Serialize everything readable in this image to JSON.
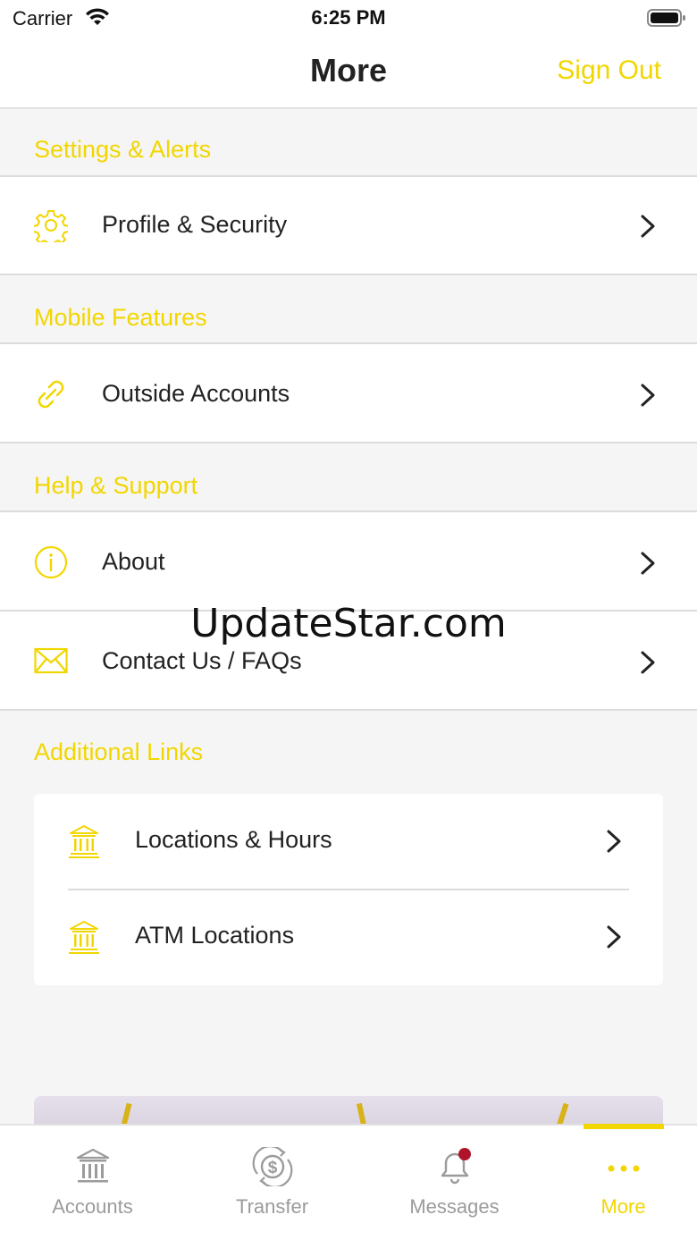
{
  "status_bar": {
    "carrier": "Carrier",
    "time": "6:25 PM"
  },
  "header": {
    "title": "More",
    "sign_out": "Sign Out"
  },
  "sections": {
    "settings": {
      "title": "Settings & Alerts",
      "items": [
        {
          "label": "Profile & Security",
          "icon": "gear-icon"
        }
      ]
    },
    "mobile": {
      "title": "Mobile Features",
      "items": [
        {
          "label": "Outside Accounts",
          "icon": "link-icon"
        }
      ]
    },
    "help": {
      "title": "Help & Support",
      "items": [
        {
          "label": "About",
          "icon": "info-icon"
        },
        {
          "label": "Contact Us / FAQs",
          "icon": "envelope-icon"
        }
      ]
    },
    "additional": {
      "title": "Additional Links",
      "items": [
        {
          "label": "Locations & Hours",
          "icon": "bank-icon"
        },
        {
          "label": "ATM Locations",
          "icon": "bank-icon"
        }
      ]
    }
  },
  "watermark": "UpdateStar.com",
  "tabs": [
    {
      "label": "Accounts",
      "icon": "bank-icon"
    },
    {
      "label": "Transfer",
      "icon": "transfer-dollar-icon"
    },
    {
      "label": "Messages",
      "icon": "bell-icon"
    },
    {
      "label": "More",
      "icon": "more-dots-icon",
      "active": true
    }
  ],
  "colors": {
    "accent": "#f2d600",
    "inactive_tab": "#9b9b9b",
    "badge": "#b0142a",
    "background": "#f5f5f5"
  }
}
